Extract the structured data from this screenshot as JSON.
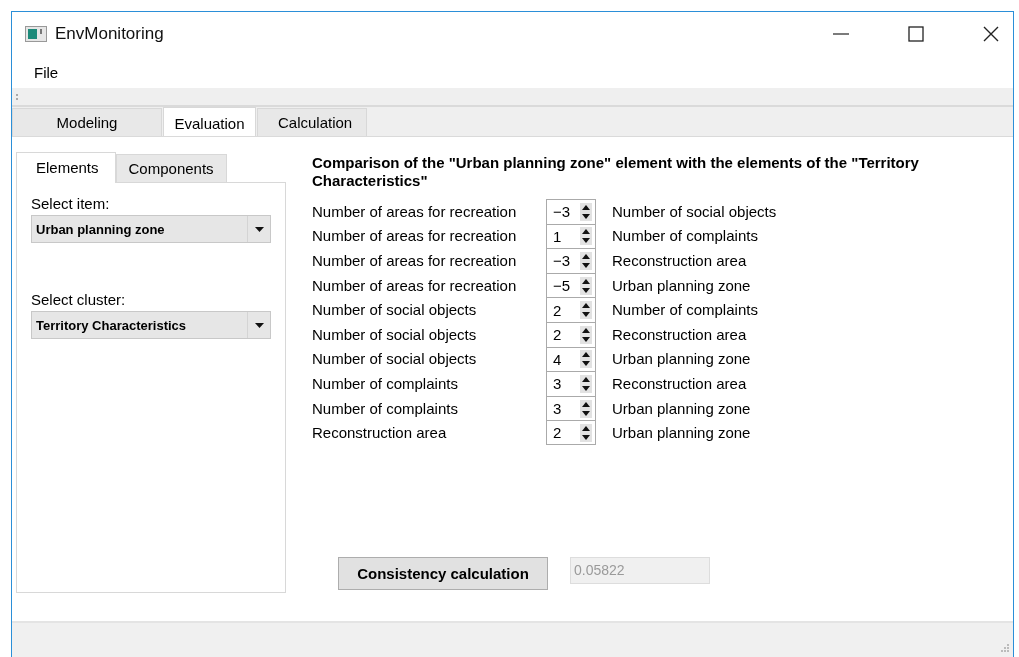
{
  "window": {
    "title": "EnvMonitoring"
  },
  "menu": [
    "File"
  ],
  "tabs": [
    {
      "label": "Modeling",
      "selected": false
    },
    {
      "label": "Evaluation",
      "selected": true
    },
    {
      "label": "Calculation",
      "selected": false
    }
  ],
  "sub_tabs": [
    {
      "label": "Elements",
      "selected": true
    },
    {
      "label": "Components",
      "selected": false
    }
  ],
  "select_item": {
    "label": "Select item:",
    "value": "Urban planning zone"
  },
  "select_cluster": {
    "label": "Select cluster:",
    "value": "Territory Characteristics"
  },
  "comparison": {
    "title": "Comparison of the \"Urban planning zone\" element with the elements of the \"Territory Characteristics\"",
    "rows": [
      {
        "left": "Number of areas for recreation",
        "value": "−3",
        "right": "Number of social objects"
      },
      {
        "left": "Number of areas for recreation",
        "value": "1",
        "right": "Number of complaints"
      },
      {
        "left": "Number of areas for recreation",
        "value": "−3",
        "right": "Reconstruction area"
      },
      {
        "left": "Number of areas for recreation",
        "value": "−5",
        "right": "Urban planning zone"
      },
      {
        "left": "Number of social objects",
        "value": "2",
        "right": "Number of complaints"
      },
      {
        "left": "Number of social objects",
        "value": "2",
        "right": "Reconstruction area"
      },
      {
        "left": "Number of social objects",
        "value": "4",
        "right": "Urban planning zone"
      },
      {
        "left": "Number of complaints",
        "value": "3",
        "right": "Reconstruction area"
      },
      {
        "left": "Number of complaints",
        "value": "3",
        "right": "Urban planning zone"
      },
      {
        "left": "Reconstruction area",
        "value": "2",
        "right": "Urban planning zone"
      }
    ]
  },
  "button": "Consistency calculation",
  "result": {
    "value": "0.05822",
    "disabled": true
  }
}
